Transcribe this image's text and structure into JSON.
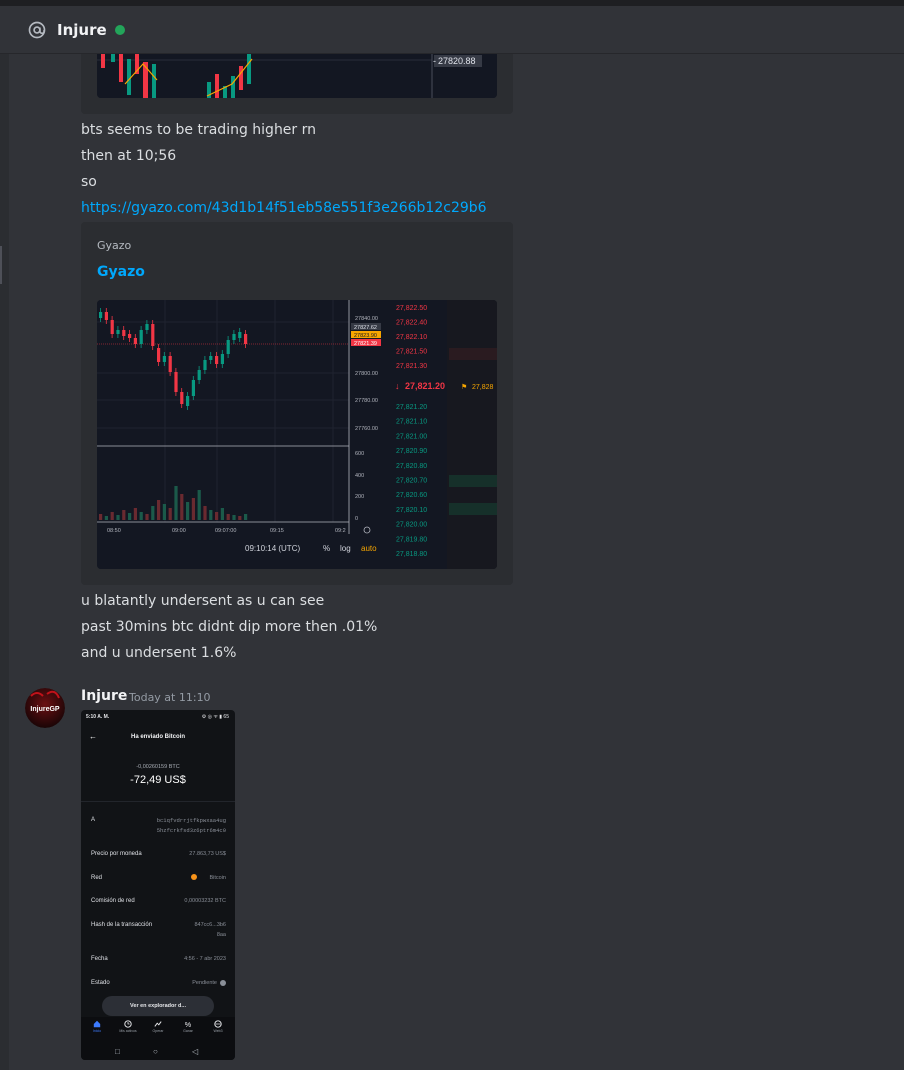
{
  "channel": {
    "name": "Injure",
    "status_color": "#23a55a"
  },
  "message1": {
    "lines": [
      "bts seems to be trading higher rn",
      "then at 10;56",
      "so"
    ],
    "link": "https://gyazo.com/43d1b14f51eb58e551f3e266b12c29b6",
    "embed1_price_label": "27820.88",
    "embed": {
      "provider": "Gyazo",
      "title": "Gyazo",
      "chart": {
        "price_labels": [
          "27840.00",
          "27827.62",
          "27823.90",
          "27821.39",
          "27800.00",
          "27780.00",
          "27760.00"
        ],
        "volume_labels": [
          "600",
          "400",
          "200",
          "0"
        ],
        "time_labels": [
          "08:50",
          "09:00",
          "09:07:00",
          "09:15",
          "09:2"
        ],
        "clock": "09:10:14 (UTC)",
        "controls": [
          "%",
          "log",
          "auto"
        ],
        "orderbook_asks": [
          "27,822.50",
          "27,822.40",
          "27,822.10",
          "27,821.50",
          "27,821.30"
        ],
        "orderbook_mid": "27,821.20",
        "orderbook_flag": "27,828",
        "orderbook_bids": [
          "27,821.20",
          "27,821.10",
          "27,821.00",
          "27,820.90",
          "27,820.80",
          "27,820.70",
          "27,820.60",
          "27,820.10",
          "27,820.00",
          "27,819.80",
          "27,818.80"
        ]
      }
    },
    "after_lines": [
      "u blatantly undersent as u can see",
      "past 30mins btc didnt dip more then .01%",
      "and u undersent 1.6%"
    ]
  },
  "message2": {
    "author": "Injure",
    "timestamp": "Today at 11:10",
    "avatar_text": "InjureGP",
    "phone": {
      "status_time": "5:10 A. M.",
      "status_icons": "⚙ ◎ ᯤ ▮ 65",
      "title": "Ha enviado Bitcoin",
      "btc_amount": "-0,00260159 BTC",
      "usd_amount": "-72,49 US$",
      "rows": [
        {
          "label": "A",
          "value": "bc1qfvdrrjtfkpwxaa4ug",
          "value2": "5hzfcrkfsd3z6ptr6m4c0"
        },
        {
          "label": "Precio por moneda",
          "value": "27.863,73 US$"
        },
        {
          "label": "Red",
          "value": "Bitcoin"
        },
        {
          "label": "Comisión de red",
          "value": "0,00003232 BTC"
        },
        {
          "label": "Hash de la transacción",
          "value": "847cc6...3b6",
          "value2": "8aa"
        },
        {
          "label": "Fecha",
          "value": "4:56 - 7 abr 2023"
        },
        {
          "label": "Estado",
          "value": "Pendiente"
        }
      ],
      "explorer_button": "Ver en explorador d...",
      "nav": [
        "Inicio",
        "Mis activos",
        "Operar",
        "Ganar",
        "Web3"
      ],
      "android_nav": [
        "□",
        "○",
        "◁"
      ]
    }
  }
}
